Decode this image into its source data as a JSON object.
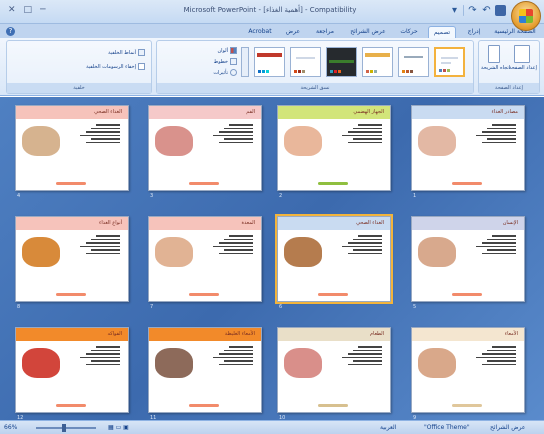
{
  "window": {
    "title": "Microsoft PowerPoint - [ﺃﻫﻤﻴﺔ ﺍﻟﻐﺬﺍﺀ] - Compatibility",
    "controls": [
      "─",
      "□",
      "✕"
    ]
  },
  "tabs": [
    {
      "label": "الصفحة الرئيسية",
      "active": false
    },
    {
      "label": "إدراج",
      "active": false
    },
    {
      "label": "تصميم",
      "active": true
    },
    {
      "label": "حركات",
      "active": false
    },
    {
      "label": "عرض الشرائح",
      "active": false
    },
    {
      "label": "مراجعة",
      "active": false
    },
    {
      "label": "عرض",
      "active": false
    },
    {
      "label": "Acrobat",
      "active": false
    }
  ],
  "ribbon": {
    "page_setup": {
      "label": "إعداد الصفحة",
      "setup_button": "إعداد الصفحة",
      "orientation_button": "اتجاه الشريحة"
    },
    "themes": {
      "label": "نسق الشريحة",
      "colors": "ألوان",
      "fonts": "خطوط",
      "effects": "تأثيرات"
    },
    "background": {
      "label": "خلفية",
      "styles": "أنماط الخلفية",
      "hide": "إخفاء الرسومات الخلفية"
    }
  },
  "slides": [
    {
      "num": "1",
      "header": "مصادر الغذاء",
      "color": "#c9dbf1",
      "pic": "#e3b8a4",
      "btn": "#f28b6b"
    },
    {
      "num": "2",
      "header": "الجهاز الهضمي",
      "color": "#d2e57a",
      "pic": "#e9b79b",
      "btn": "#8fbf3f"
    },
    {
      "num": "3",
      "header": "الفم",
      "color": "#f5c9c9",
      "pic": "#d9928c",
      "btn": "#f28b6b"
    },
    {
      "num": "4",
      "header": "الغذاء الصحي",
      "color": "#f6c3bb",
      "pic": "#d6b38f",
      "btn": "#f28b6b"
    },
    {
      "num": "5",
      "header": "الإنسان",
      "color": "#cfd4ea",
      "pic": "#d8a98d",
      "btn": "#f28b6b"
    },
    {
      "num": "6",
      "header": "الغذاء الصحي",
      "color": "#c9dbf1",
      "pic": "#b57c4e",
      "btn": "#f28b6b"
    },
    {
      "num": "7",
      "header": "المعدة",
      "color": "#f6c3bb",
      "pic": "#e1b394",
      "btn": "#f28b6b"
    },
    {
      "num": "8",
      "header": "أنواع الغذاء",
      "color": "#f6c3bb",
      "pic": "#d88a3a",
      "btn": "#f28b6b"
    },
    {
      "num": "9",
      "header": "الأمعاء",
      "color": "#f4e6d0",
      "pic": "#d9a88a",
      "btn": "#e0c79b"
    },
    {
      "num": "10",
      "header": "الطعام",
      "color": "#e9dfc8",
      "pic": "#d98f8a",
      "btn": "#d7c08f"
    },
    {
      "num": "11",
      "header": "الأمعاء الغليظة",
      "color": "#f28a2a",
      "pic": "#8d6a5a",
      "btn": "#f28b6b"
    },
    {
      "num": "12",
      "header": "الفواكه",
      "color": "#f28a2a",
      "pic": "#d2453b",
      "btn": "#f28b6b"
    }
  ],
  "status": {
    "view_label": "عرض الشرائح",
    "theme_label": "\"Office Theme\"",
    "language": "العربية",
    "zoom": "66%"
  }
}
